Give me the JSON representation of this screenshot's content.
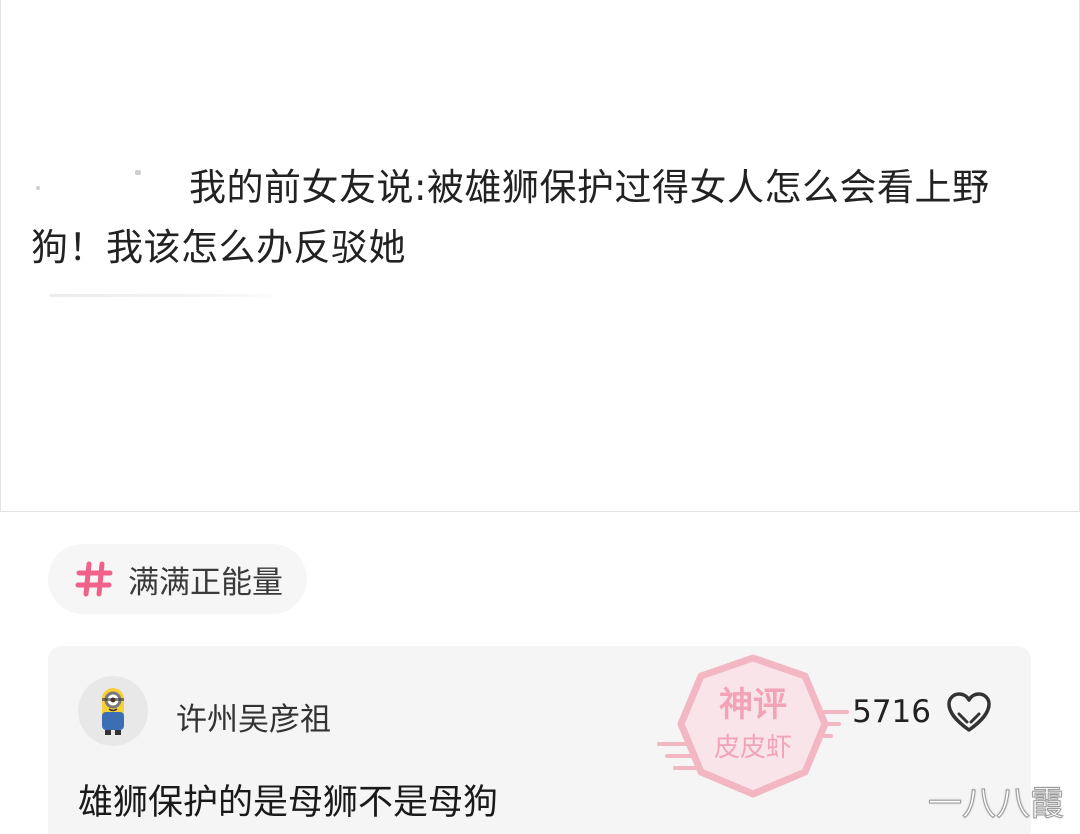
{
  "post": {
    "text": "我的前女友说:被雄狮保护过得女人怎么会看上野狗！我该怎么办反驳她"
  },
  "topic": {
    "icon": "hash-icon",
    "label": "满满正能量"
  },
  "comment": {
    "avatar": "minion-avatar",
    "username": "许州吴彦祖",
    "likes": "5716",
    "like_icon": "heart-outline-icon",
    "text": "雄狮保护的是母狮不是母狗"
  },
  "stamp": {
    "line1": "神评",
    "line2": "皮皮虾"
  },
  "watermark": {
    "text": "一八八霞"
  },
  "colors": {
    "accent_pink": "#f0628a",
    "stamp_pink": "#f3a3b4",
    "card_bg": "#f5f5f5",
    "pill_bg": "#f6f6f6"
  }
}
